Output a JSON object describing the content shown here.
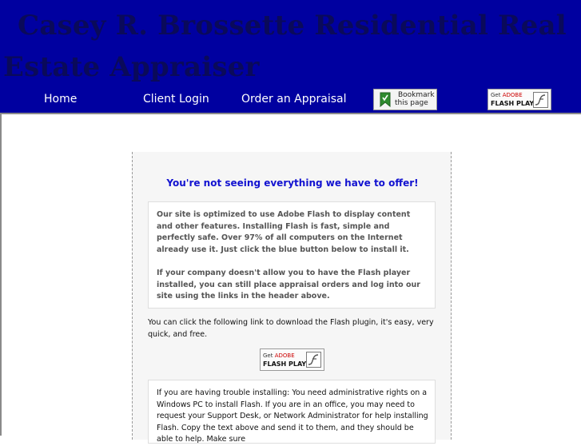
{
  "header": {
    "title": "Casey R. Brossette Residential Real Estate Appraiser",
    "nav": [
      "Home",
      "Client Login",
      "Order an Appraisal"
    ],
    "bookmark_line1": "Bookmark",
    "bookmark_line2": "this page",
    "flash_get": "Get",
    "flash_adobe": "ADOBE",
    "flash_player": "FLASH PLAYER"
  },
  "main": {
    "warning": "You're not seeing everything we have to offer!",
    "info_p1": "Our site is optimized to use Adobe Flash to display content and other features. Installing Flash is fast, simple and perfectly safe. Over 97% of all computers on the Internet already use it. Just click the blue button below to install it.",
    "info_p2": "If your company doesn't allow you to have the Flash player installed, you can still place appraisal orders and log into our site using the links in the header above.",
    "link_text": "You can click the following link to download the Flash plugin, it's easy, very quick, and free.",
    "trouble_text": "If you are having trouble installing: You need administrative rights on a Windows PC to install Flash. If you are in an office, you may need to request your Support Desk, or Network Administrator for help installing Flash. Copy the text above and send it to them, and they should be able to help. Make sure"
  },
  "colors": {
    "header_bg": "#0000a0",
    "title": "#0a0a5a",
    "warning": "#1212d0"
  }
}
